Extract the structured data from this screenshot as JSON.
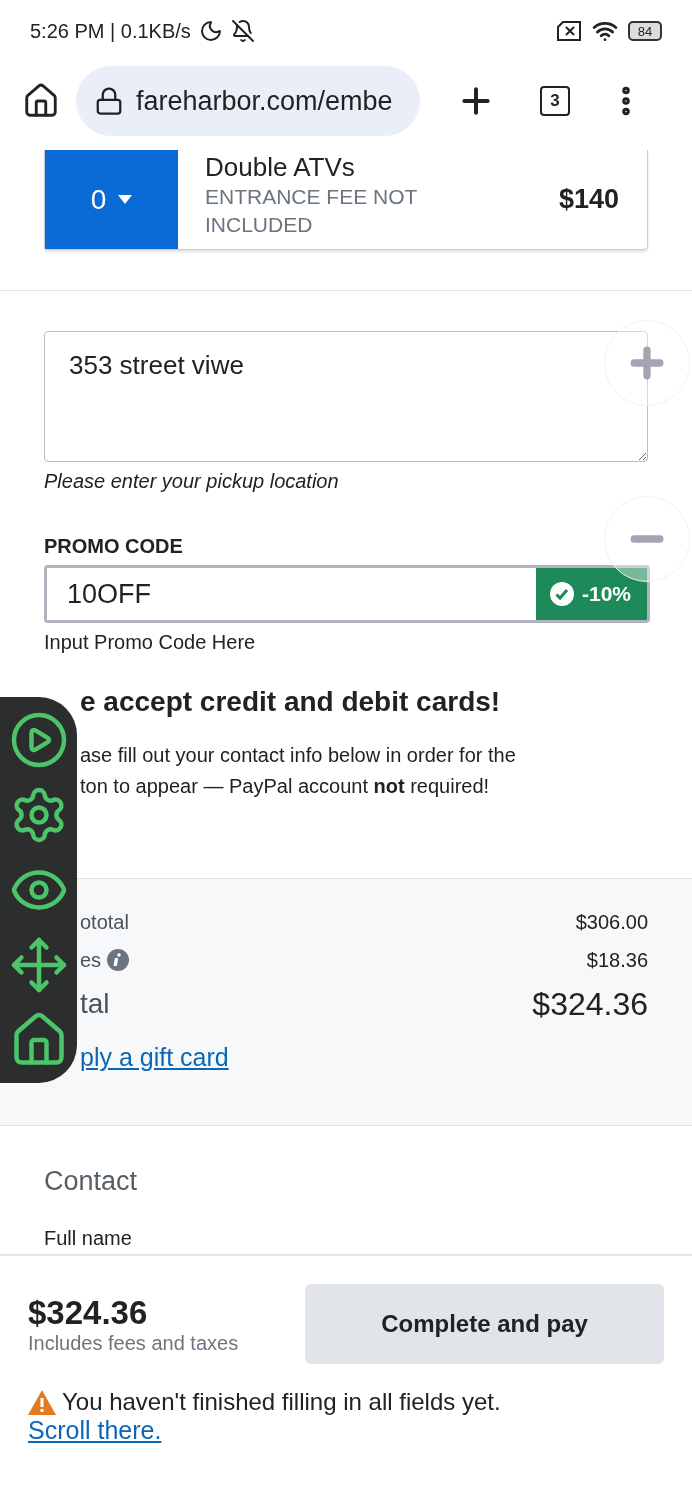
{
  "status_bar": {
    "time_speed": "5:26 PM | 0.1KB/s",
    "battery": "84"
  },
  "browser": {
    "url": "fareharbor.com/embe",
    "tab_count": "3"
  },
  "item": {
    "quantity": "0",
    "name": "Double ATVs",
    "note": "ENTRANCE FEE NOT INCLUDED",
    "price": "$140"
  },
  "pickup": {
    "value": "353 street viwe",
    "help": "Please enter your pickup location"
  },
  "promo": {
    "label": "PROMO CODE",
    "value": "10OFF",
    "applied": true,
    "discount": "-10%",
    "help": "Input Promo Code Here"
  },
  "payment_note": {
    "title": "e accept credit and debit cards!",
    "lines": [
      "ase fill out your contact info below in order for the",
      "ton to appear — PayPal account **not** required!"
    ]
  },
  "summary": {
    "rows": [
      {
        "label": "ototal",
        "value": "$306.00",
        "kind": "line",
        "info": false
      },
      {
        "label": "es",
        "value": "$18.36",
        "kind": "line",
        "info": true
      },
      {
        "label": "tal",
        "value": "$324.36",
        "kind": "total",
        "info": false
      }
    ],
    "gift_link": "ply a gift card"
  },
  "contact": {
    "title": "Contact",
    "field_label": "Full name"
  },
  "footer": {
    "total": "$324.36",
    "note": "Includes fees and taxes",
    "button": "Complete and pay",
    "warning": "You haven't finished filling in all fields yet.",
    "warning_link": "Scroll there."
  }
}
